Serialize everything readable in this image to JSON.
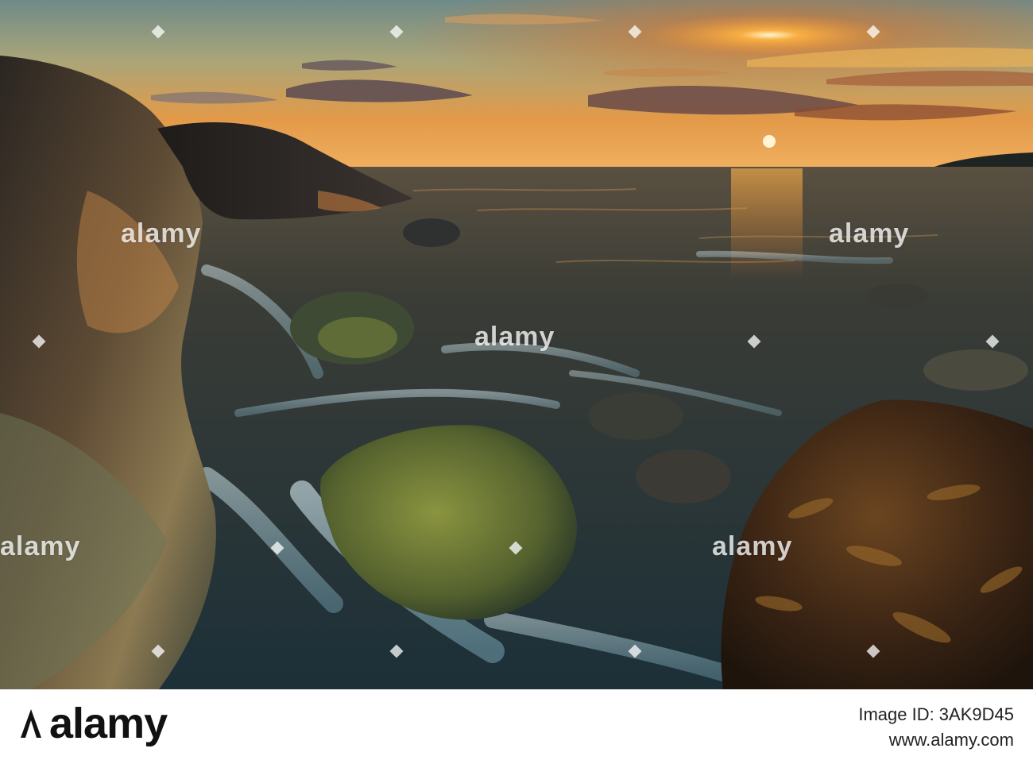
{
  "photo": {
    "subject": "coastal-sunset-seascape",
    "palette": {
      "sky_top": "#7a8f8a",
      "sky_mid": "#e8a04a",
      "sun": "#fff6c8",
      "sea": "#2e3a3c",
      "foam": "#cfe6ee",
      "rock_dark": "#2a2826",
      "rock_lit": "#c98a4a",
      "moss": "#6e7a3a",
      "seaweed": "#5a3a1c"
    }
  },
  "watermark": {
    "word": "alamy",
    "logo_text": "alamy"
  },
  "footer": {
    "logo_text": "alamy",
    "image_id": "Image ID: 3AK9D45",
    "url": "www.alamy.com",
    "logo_color": "#111111",
    "text_color": "#222222"
  }
}
